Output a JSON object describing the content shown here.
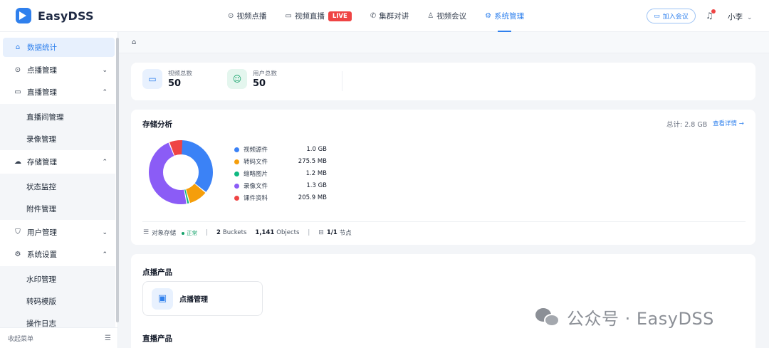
{
  "app": {
    "name": "EasyDSS"
  },
  "nav": {
    "items": [
      {
        "label": "视频点播",
        "icon": "play-circle-icon"
      },
      {
        "label": "视频直播",
        "icon": "video-camera-icon",
        "badge": "LIVE"
      },
      {
        "label": "集群对讲",
        "icon": "phone-icon"
      },
      {
        "label": "视频会议",
        "icon": "users-icon"
      },
      {
        "label": "系统管理",
        "icon": "gear-icon",
        "active": true
      }
    ],
    "join_button": "加入会议",
    "user_name": "小李"
  },
  "sidebar": {
    "items": [
      {
        "label": "数据统计",
        "icon": "home-icon",
        "active": true
      },
      {
        "label": "点播管理",
        "icon": "play-circle-icon",
        "expanded": false
      },
      {
        "label": "直播管理",
        "icon": "video-camera-icon",
        "expanded": true,
        "children": [
          "直播间管理",
          "录像管理"
        ]
      },
      {
        "label": "存储管理",
        "icon": "cloud-icon",
        "expanded": true,
        "children": [
          "状态监控",
          "附件管理"
        ]
      },
      {
        "label": "用户管理",
        "icon": "shield-icon",
        "expanded": false
      },
      {
        "label": "系统设置",
        "icon": "gear-icon",
        "expanded": true,
        "children": [
          "水印管理",
          "转码模版",
          "操作日志"
        ]
      }
    ],
    "collapse_label": "收起菜单"
  },
  "stats": [
    {
      "label": "视频总数",
      "value": "50",
      "icon": "video-icon",
      "color": "#2f80ed"
    },
    {
      "label": "用户总数",
      "value": "50",
      "icon": "users-icon",
      "color": "#16a36b"
    }
  ],
  "storage": {
    "title": "存储分析",
    "total_label": "总计: 2.8 GB",
    "detail_link": "查看详情 →",
    "segments": [
      {
        "name": "视频源件",
        "value_label": "1.0 GB",
        "value_mb": 1024,
        "color": "#3b82f6"
      },
      {
        "name": "转码文件",
        "value_label": "275.5 MB",
        "value_mb": 275.5,
        "color": "#f59e0b"
      },
      {
        "name": "缩略图片",
        "value_label": "1.2 MB",
        "value_mb": 1.2,
        "color": "#10b981"
      },
      {
        "name": "录像文件",
        "value_label": "1.3 GB",
        "value_mb": 1331,
        "color": "#8b5cf6"
      },
      {
        "name": "课件资料",
        "value_label": "205.9 MB",
        "value_mb": 205.9,
        "color": "#ef4444"
      }
    ],
    "footer": {
      "storage_type": "对象存储",
      "status": "正常",
      "buckets_num": "2",
      "buckets_label": "Buckets",
      "objects_num": "1,141",
      "objects_label": "Objects",
      "nodes_num": "1/1",
      "nodes_label": "节点"
    }
  },
  "products": {
    "vod_title": "点播产品",
    "vod_item": "点播管理",
    "live_title": "直播产品"
  },
  "watermark": {
    "text": "公众号 · EasyDSS"
  }
}
